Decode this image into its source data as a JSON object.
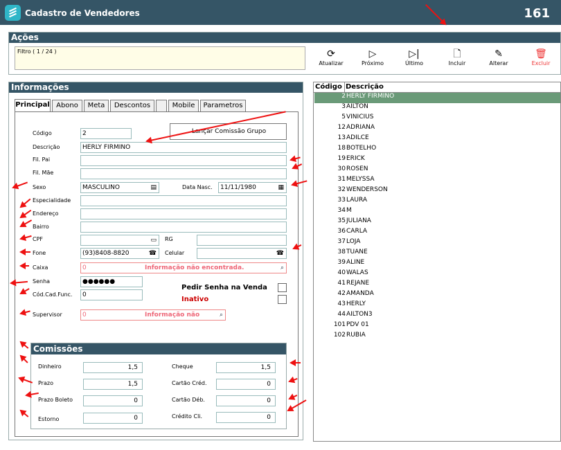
{
  "window": {
    "title": "Cadastro de Vendedores",
    "record_number": "161"
  },
  "acoes": {
    "title": "Ações",
    "filter_text": "Filtro ( 1 / 24 )",
    "toolbar": [
      {
        "label": "Atualizar",
        "icon": "refresh-icon"
      },
      {
        "label": "Próximo",
        "icon": "next-icon"
      },
      {
        "label": "Último",
        "icon": "last-icon"
      },
      {
        "label": "Incluir",
        "icon": "new-document-icon"
      },
      {
        "label": "Alterar",
        "icon": "edit-icon"
      },
      {
        "label": "Excluir",
        "icon": "trash-icon"
      }
    ]
  },
  "info": {
    "title": "Informações",
    "tabs": [
      "Principal",
      "Abono",
      "Meta",
      "Descontos",
      "",
      "Mobile",
      "Parametros"
    ],
    "lancar_label": "Lançar Comissão Grupo",
    "labels": {
      "codigo": "Código",
      "descricao": "Descrição",
      "fil_pai": "Fil. Pai",
      "fil_mae": "Fil. Mãe",
      "sexo": "Sexo",
      "data_nasc": "Data Nasc.",
      "especialidade": "Especialidade",
      "endereco": "Endereço",
      "bairro": "Bairro",
      "cpf": "CPF",
      "rg": "RG",
      "fone": "Fone",
      "celular": "Celular",
      "caixa": "Caixa",
      "senha": "Senha",
      "cod_cad_func": "Cód.Cad.Func.",
      "supervisor": "Supervisor",
      "pedir_senha": "Pedir Senha na Venda",
      "inativo": "Inativo"
    },
    "values": {
      "codigo": "2",
      "descricao": "HERLY  FIRMINO",
      "sexo": "MASCULINO",
      "data_nasc": "11/11/1980",
      "fone": "(93)8408-8820",
      "caixa_code": "0",
      "caixa_msg": "Informação não encontrada.",
      "senha": "●●●●●●",
      "cod_cad_func": "0",
      "supervisor_code": "0",
      "supervisor_msg": "Informação não"
    },
    "comissoes": {
      "title": "Comissões",
      "dinheiro": {
        "label": "Dinheiro",
        "value": "1,5"
      },
      "cheque": {
        "label": "Cheque",
        "value": "1,5"
      },
      "prazo": {
        "label": "Prazo",
        "value": "1,5"
      },
      "cartao_cred": {
        "label": "Cartão Créd.",
        "value": "0"
      },
      "prazo_boleto": {
        "label": "Prazo Boleto",
        "value": "0"
      },
      "cartao_deb": {
        "label": "Cartão Déb.",
        "value": "0"
      },
      "estorno": {
        "label": "Estorno",
        "value": "0"
      },
      "credito_cli": {
        "label": "Crédito Cli.",
        "value": "0"
      }
    }
  },
  "grid": {
    "headers": [
      "Código",
      "Descrição"
    ],
    "selected_index": 0,
    "rows": [
      [
        "2",
        "HERLY  FIRMINO"
      ],
      [
        "3",
        "AILTON"
      ],
      [
        "5",
        "VINICIUS"
      ],
      [
        "12",
        "ADRIANA"
      ],
      [
        "13",
        "ADILCE"
      ],
      [
        "18",
        "BOTELHO"
      ],
      [
        "19",
        "ERICK"
      ],
      [
        "30",
        "ROSEN"
      ],
      [
        "31",
        "MELYSSA"
      ],
      [
        "32",
        "WENDERSON"
      ],
      [
        "33",
        "LAURA"
      ],
      [
        "34",
        "M"
      ],
      [
        "35",
        "JULIANA"
      ],
      [
        "36",
        "CARLA"
      ],
      [
        "37",
        "LOJA"
      ],
      [
        "38",
        "TUANE"
      ],
      [
        "39",
        "ALINE"
      ],
      [
        "40",
        "WALAS"
      ],
      [
        "41",
        "REJANE"
      ],
      [
        "42",
        "AMANDA"
      ],
      [
        "43",
        "HERLY"
      ],
      [
        "44",
        "AILTON3"
      ],
      [
        "101",
        "PDV 01"
      ],
      [
        "102",
        "RUBIA"
      ]
    ]
  },
  "colors": {
    "header_bg": "#355566",
    "selected_row": "#6a9a78",
    "annotation": "#ee1111"
  }
}
